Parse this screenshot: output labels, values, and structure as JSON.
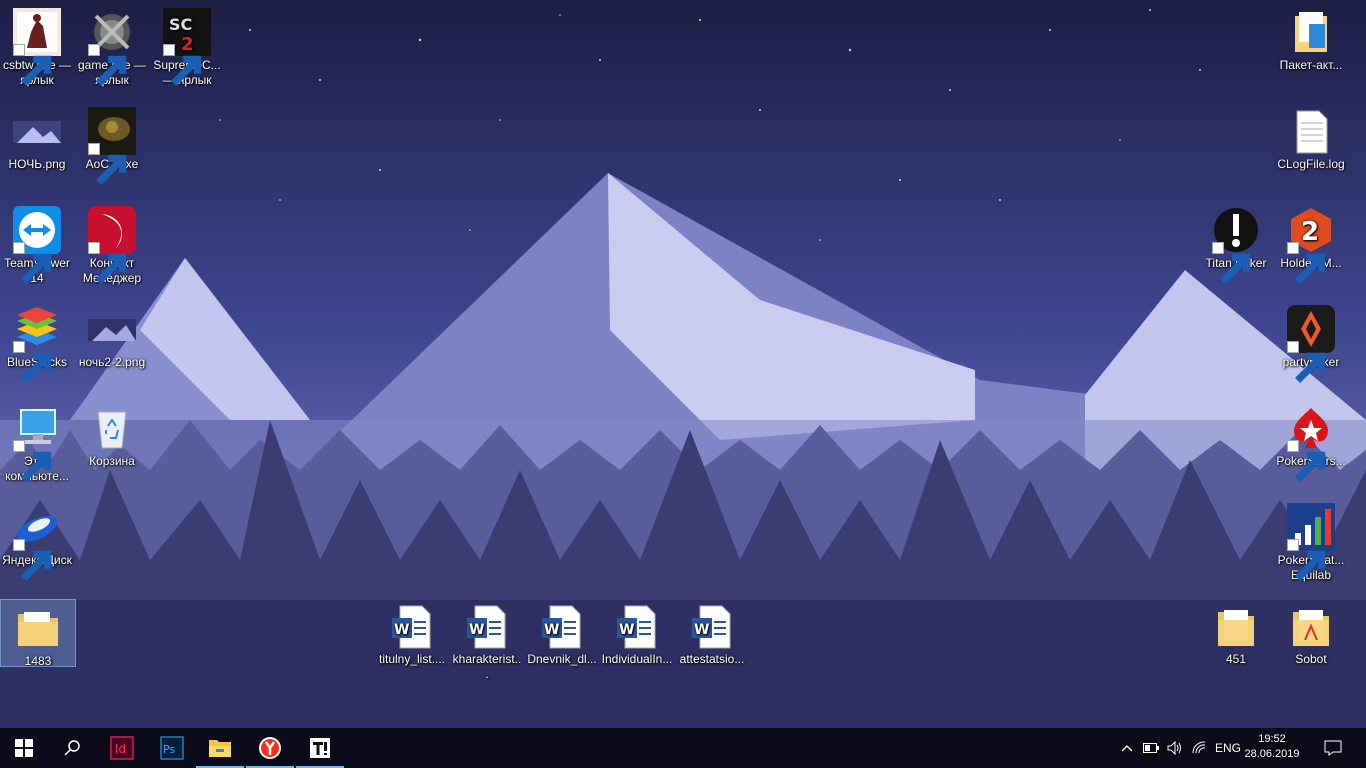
{
  "desktop": {
    "icons": {
      "csbtw": "csbtw.exe — ярлык",
      "game": "game.exe — ярлык",
      "supremec": "SupremeC... — ярлык",
      "paket": "Пакет-акт...",
      "noch": "НОЧЬ.png",
      "aoc2": "AoC2.exe",
      "clogfile": "CLogFile.log",
      "teamviewer": "TeamViewer 14",
      "konnekt": "Коннект Менеджер",
      "titanpoker": "Titan Poker",
      "holdem": "HoldemM...",
      "bluestacks": "BlueStacks",
      "noch2": "ночь2-2.png",
      "partypoker": "partypoker",
      "computer": "Этот компьюте...",
      "recycle": "Корзина",
      "pokerstars": "PokerStars...",
      "yandexdisk": "Яндекс.Диск",
      "pokerstrat": "PokerStrat... Equilab",
      "folder1483": "1483",
      "doc1": "titulny_list....",
      "doc2": "kharakterist...",
      "doc3": "Dnevnik_dl...",
      "doc4": "IndividualIn...",
      "doc5": "attestatsio...",
      "folder451": "451",
      "sobot": "Sobot"
    }
  },
  "taskbar": {
    "language": "ENG",
    "time": "19:52",
    "date": "28.06.2019",
    "apps": [
      "start",
      "search",
      "indesign",
      "photoshop",
      "file-explorer",
      "yandex-browser",
      "typora"
    ]
  }
}
